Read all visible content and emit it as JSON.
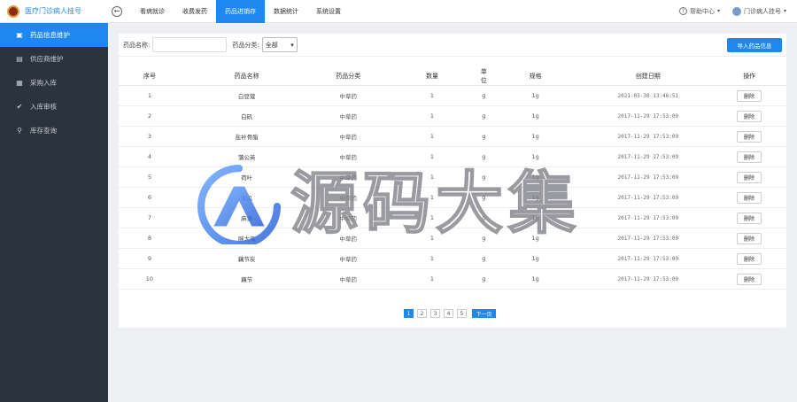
{
  "app": {
    "title": "医疗门诊病人挂号"
  },
  "sidebar": {
    "items": [
      {
        "label": "药品信息维护",
        "icon": "briefcase-icon",
        "active": true
      },
      {
        "label": "供应商维护",
        "icon": "truck-icon",
        "active": false
      },
      {
        "label": "采购入库",
        "icon": "cart-icon",
        "active": false
      },
      {
        "label": "入库审核",
        "icon": "check-icon",
        "active": false
      },
      {
        "label": "库存查询",
        "icon": "search-icon",
        "active": false
      }
    ]
  },
  "topnav": {
    "tabs": [
      {
        "label": "看病就诊"
      },
      {
        "label": "收费发药"
      },
      {
        "label": "药品进销存",
        "active": true
      },
      {
        "label": "数据统计"
      },
      {
        "label": "系统设置"
      }
    ],
    "help": "帮助中心",
    "user": "门诊病人挂号"
  },
  "filters": {
    "name_label": "药品名称:",
    "name_value": "",
    "category_label": "药品分类:",
    "category_selected": "全部",
    "import_button": "导入药品信息"
  },
  "table": {
    "headers": [
      "序号",
      "药品名称",
      "药品分类",
      "数量",
      "单位",
      "规格",
      "创建日期",
      "操作"
    ],
    "rows": [
      [
        "1",
        "白豆蔻",
        "中草药",
        "1",
        "g",
        "1g",
        "2021-03-30 13:46:51",
        "删除"
      ],
      [
        "2",
        "白矾",
        "中草药",
        "1",
        "g",
        "1g",
        "2017-11-29 17:53:09",
        "删除"
      ],
      [
        "3",
        "盐补骨脂",
        "中草药",
        "1",
        "g",
        "1g",
        "2017-11-29 17:53:09",
        "删除"
      ],
      [
        "4",
        "蒲公英",
        "中草药",
        "1",
        "g",
        "1g",
        "2017-11-29 17:53:09",
        "删除"
      ],
      [
        "5",
        "荷叶",
        "中草药",
        "1",
        "g",
        "1g",
        "2017-11-29 17:53:09",
        "删除"
      ],
      [
        "6",
        "木瓜",
        "中草药",
        "1",
        "g",
        "1g",
        "2017-11-29 17:53:09",
        "删除"
      ],
      [
        "7",
        "麻黄",
        "中草药",
        "1",
        "g",
        "1g",
        "2017-11-29 17:53:09",
        "删除"
      ],
      [
        "8",
        "胖大海",
        "中草药",
        "1",
        "g",
        "1g",
        "2017-11-29 17:53:09",
        "删除"
      ],
      [
        "9",
        "藕节炭",
        "中草药",
        "1",
        "g",
        "1g",
        "2017-11-29 17:53:09",
        "删除"
      ],
      [
        "10",
        "藕节",
        "中草药",
        "1",
        "g",
        "1g",
        "2017-11-29 17:53:09",
        "删除"
      ]
    ]
  },
  "pager": {
    "pages": [
      "1",
      "2",
      "3",
      "4",
      "5"
    ],
    "current": "1",
    "next": "下一页"
  },
  "watermark": {
    "text": "源码大集"
  },
  "colors": {
    "accent": "#1e87f0",
    "sidebar_bg": "#2b333e"
  }
}
